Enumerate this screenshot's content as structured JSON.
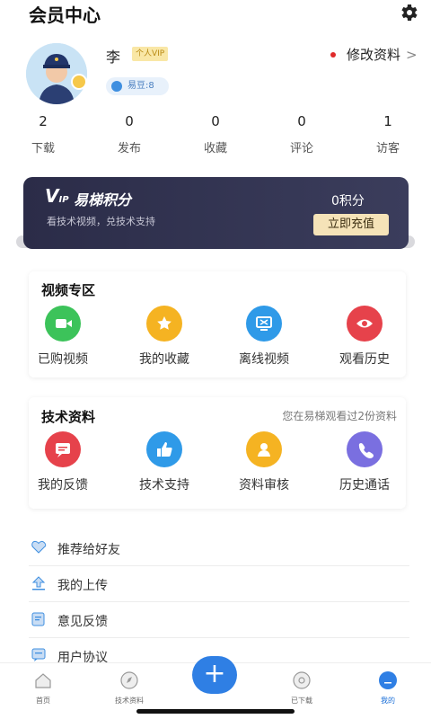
{
  "header": {
    "title": "会员中心",
    "settings_icon": "gear-icon"
  },
  "profile": {
    "name": "李",
    "vip_tag": "个人VIP",
    "beans": "易豆:8",
    "edit_label": "修改资料",
    "edit_chevron": ">"
  },
  "stats": [
    {
      "value": "2",
      "label": "下载"
    },
    {
      "value": "0",
      "label": "发布"
    },
    {
      "value": "0",
      "label": "收藏"
    },
    {
      "value": "0",
      "label": "评论"
    },
    {
      "value": "1",
      "label": "访客"
    }
  ],
  "vip_card": {
    "logo_v": "V",
    "logo_ip": "IP",
    "title": "易梯积分",
    "subtitle": "看技术视频，兑技术支持",
    "points": "0积分",
    "button": "立即充值"
  },
  "video_section": {
    "title": "视频专区",
    "items": [
      {
        "label": "已购视频",
        "icon": "video-camera-icon",
        "color": "#3cc35a"
      },
      {
        "label": "我的收藏",
        "icon": "star-icon",
        "color": "#f5b322"
      },
      {
        "label": "离线视频",
        "icon": "monitor-icon",
        "color": "#2f9ae8"
      },
      {
        "label": "观看历史",
        "icon": "eye-icon",
        "color": "#e6424b"
      }
    ]
  },
  "tech_section": {
    "title": "技术资料",
    "note": "您在易梯观看过2份资料",
    "items": [
      {
        "label": "我的反馈",
        "icon": "feedback-icon",
        "color": "#e6424b"
      },
      {
        "label": "技术支持",
        "icon": "thumbs-up-icon",
        "color": "#2f9ae8"
      },
      {
        "label": "资料审核",
        "icon": "person-icon",
        "color": "#f5b322"
      },
      {
        "label": "历史通话",
        "icon": "phone-icon",
        "color": "#7a6fe0"
      }
    ]
  },
  "menu": [
    {
      "label": "推荐给好友",
      "icon": "heart-icon"
    },
    {
      "label": "我的上传",
      "icon": "upload-icon"
    },
    {
      "label": "意见反馈",
      "icon": "note-icon"
    },
    {
      "label": "用户协议",
      "icon": "message-icon"
    }
  ],
  "tabbar": [
    {
      "label": "首页",
      "icon": "home-icon"
    },
    {
      "label": "技术资料",
      "icon": "compass-icon"
    },
    {
      "label": "+",
      "icon": "plus-icon"
    },
    {
      "label": "已下载",
      "icon": "download-icon"
    },
    {
      "label": "我的",
      "icon": "user-icon",
      "active": true
    }
  ],
  "colors": {
    "accent": "#2f7fe4",
    "card_bg": "#2b2c48",
    "gold": "#f5e3b8"
  }
}
